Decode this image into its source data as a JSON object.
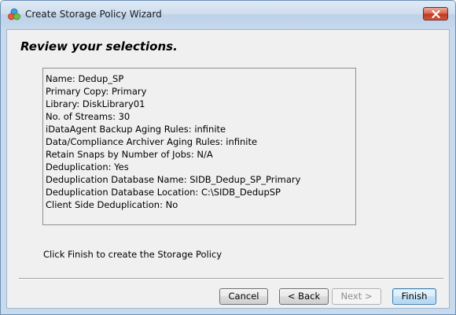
{
  "window": {
    "title": "Create Storage Policy Wizard"
  },
  "page": {
    "heading": "Review your selections."
  },
  "summary": {
    "lines": [
      "Name: Dedup_SP",
      "Primary Copy: Primary",
      "Library: DiskLibrary01",
      "No. of Streams: 30",
      "iDataAgent Backup Aging Rules: infinite",
      "Data/Compliance Archiver Aging Rules: infinite",
      "Retain Snaps by Number of Jobs:  N/A",
      "Deduplication:  Yes",
      "Deduplication Database Name:  SIDB_Dedup_SP_Primary",
      "Deduplication Database Location:  C:\\SIDB_DedupSP",
      "Client Side Deduplication:   No"
    ]
  },
  "footer": {
    "note": "Click Finish to create the Storage Policy"
  },
  "buttons": {
    "cancel": "Cancel",
    "back": "< Back",
    "next": "Next >",
    "finish": "Finish"
  },
  "icons": {
    "app": "storage-policy-icon",
    "close": "close-icon"
  },
  "colors": {
    "titlebar": "#c5d8ec",
    "close_button": "#c0391f",
    "dialog_background": "#f0f0f0",
    "default_button_border": "#3c7fb1"
  }
}
